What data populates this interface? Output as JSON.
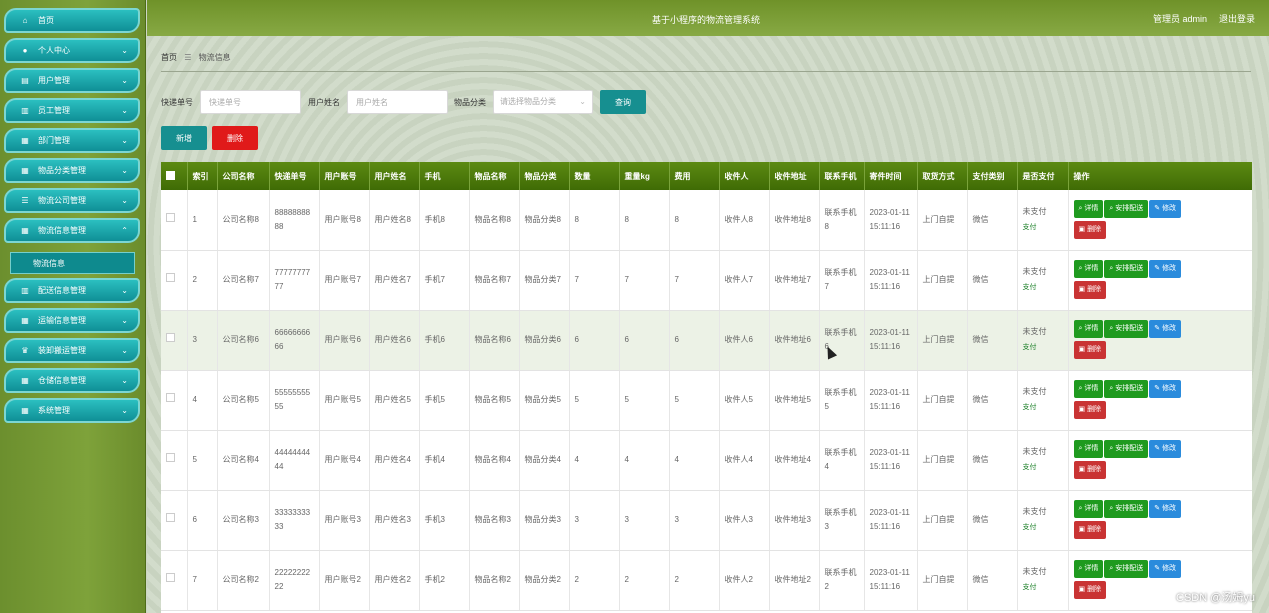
{
  "app": {
    "title": "基于小程序的物流管理系统",
    "user": "管理员 admin",
    "logout": "退出登录"
  },
  "sidebar": {
    "items": [
      {
        "label": "首页",
        "icon": "home-icon",
        "glyph": "⌂"
      },
      {
        "label": "个人中心",
        "icon": "user-icon",
        "glyph": "●"
      },
      {
        "label": "用户管理",
        "icon": "list-icon",
        "glyph": "▤"
      },
      {
        "label": "员工管理",
        "icon": "chart-icon",
        "glyph": "▥"
      },
      {
        "label": "部门管理",
        "icon": "grid-icon",
        "glyph": "▦"
      },
      {
        "label": "物品分类管理",
        "icon": "grid-icon",
        "glyph": "▦"
      },
      {
        "label": "物流公司管理",
        "icon": "sliders-icon",
        "glyph": "☰"
      },
      {
        "label": "物流信息管理",
        "icon": "grid-icon",
        "glyph": "▦"
      },
      {
        "label": "配送信息管理",
        "icon": "chart-icon",
        "glyph": "▥"
      },
      {
        "label": "运输信息管理",
        "icon": "grid-icon",
        "glyph": "▦"
      },
      {
        "label": "装卸搬运管理",
        "icon": "trophy-icon",
        "glyph": "♛"
      },
      {
        "label": "仓储信息管理",
        "icon": "grid-icon",
        "glyph": "▦"
      },
      {
        "label": "系统管理",
        "icon": "grid-icon",
        "glyph": "▦"
      }
    ],
    "submenu_label": "物流信息"
  },
  "breadcrumb": {
    "home": "首页",
    "sep": "☰",
    "current": "物流信息"
  },
  "filters": {
    "tracking_label": "快递单号",
    "tracking_placeholder": "快递单号",
    "name_label": "用户姓名",
    "name_placeholder": "用户姓名",
    "category_label": "物品分类",
    "category_placeholder": "请选择物品分类",
    "query": "查询"
  },
  "actions": {
    "add": "新增",
    "delete": "删除"
  },
  "table": {
    "headers": [
      "索引",
      "公司名称",
      "快递单号",
      "用户账号",
      "用户姓名",
      "手机",
      "物品名称",
      "物品分类",
      "数量",
      "重量kg",
      "费用",
      "收件人",
      "收件地址",
      "联系手机",
      "寄件时间",
      "取货方式",
      "支付类别",
      "是否支付",
      "操作"
    ],
    "ops": {
      "detail": "详情",
      "dispatch": "安排配送",
      "edit": "修改",
      "delete": "删除"
    },
    "rows": [
      [
        "1",
        "公司名称8",
        "8888888888",
        "用户账号8",
        "用户姓名8",
        "手机8",
        "物品名称8",
        "物品分类8",
        "8",
        "8",
        "8",
        "收件人8",
        "收件地址8",
        "联系手机8",
        "2023-01-11 15:11:16",
        "上门自提",
        "微信",
        "未支付",
        "支付"
      ],
      [
        "2",
        "公司名称7",
        "7777777777",
        "用户账号7",
        "用户姓名7",
        "手机7",
        "物品名称7",
        "物品分类7",
        "7",
        "7",
        "7",
        "收件人7",
        "收件地址7",
        "联系手机7",
        "2023-01-11 15:11:16",
        "上门自提",
        "微信",
        "未支付",
        "支付"
      ],
      [
        "3",
        "公司名称6",
        "6666666666",
        "用户账号6",
        "用户姓名6",
        "手机6",
        "物品名称6",
        "物品分类6",
        "6",
        "6",
        "6",
        "收件人6",
        "收件地址6",
        "联系手机6",
        "2023-01-11 15:11:16",
        "上门自提",
        "微信",
        "未支付",
        "支付"
      ],
      [
        "4",
        "公司名称5",
        "5555555555",
        "用户账号5",
        "用户姓名5",
        "手机5",
        "物品名称5",
        "物品分类5",
        "5",
        "5",
        "5",
        "收件人5",
        "收件地址5",
        "联系手机5",
        "2023-01-11 15:11:16",
        "上门自提",
        "微信",
        "未支付",
        "支付"
      ],
      [
        "5",
        "公司名称4",
        "4444444444",
        "用户账号4",
        "用户姓名4",
        "手机4",
        "物品名称4",
        "物品分类4",
        "4",
        "4",
        "4",
        "收件人4",
        "收件地址4",
        "联系手机4",
        "2023-01-11 15:11:16",
        "上门自提",
        "微信",
        "未支付",
        "支付"
      ],
      [
        "6",
        "公司名称3",
        "3333333333",
        "用户账号3",
        "用户姓名3",
        "手机3",
        "物品名称3",
        "物品分类3",
        "3",
        "3",
        "3",
        "收件人3",
        "收件地址3",
        "联系手机3",
        "2023-01-11 15:11:16",
        "上门自提",
        "微信",
        "未支付",
        "支付"
      ],
      [
        "7",
        "公司名称2",
        "2222222222",
        "用户账号2",
        "用户姓名2",
        "手机2",
        "物品名称2",
        "物品分类2",
        "2",
        "2",
        "2",
        "收件人2",
        "收件地址2",
        "联系手机2",
        "2023-01-11 15:11:16",
        "上门自提",
        "微信",
        "未支付",
        "支付"
      ]
    ]
  },
  "watermark": "CSDN @汤姆yu",
  "colors": {
    "topbar": "#6f9229",
    "teal": "#168f90",
    "danger": "#e01a1a",
    "table_header": "#4d7a0c"
  }
}
